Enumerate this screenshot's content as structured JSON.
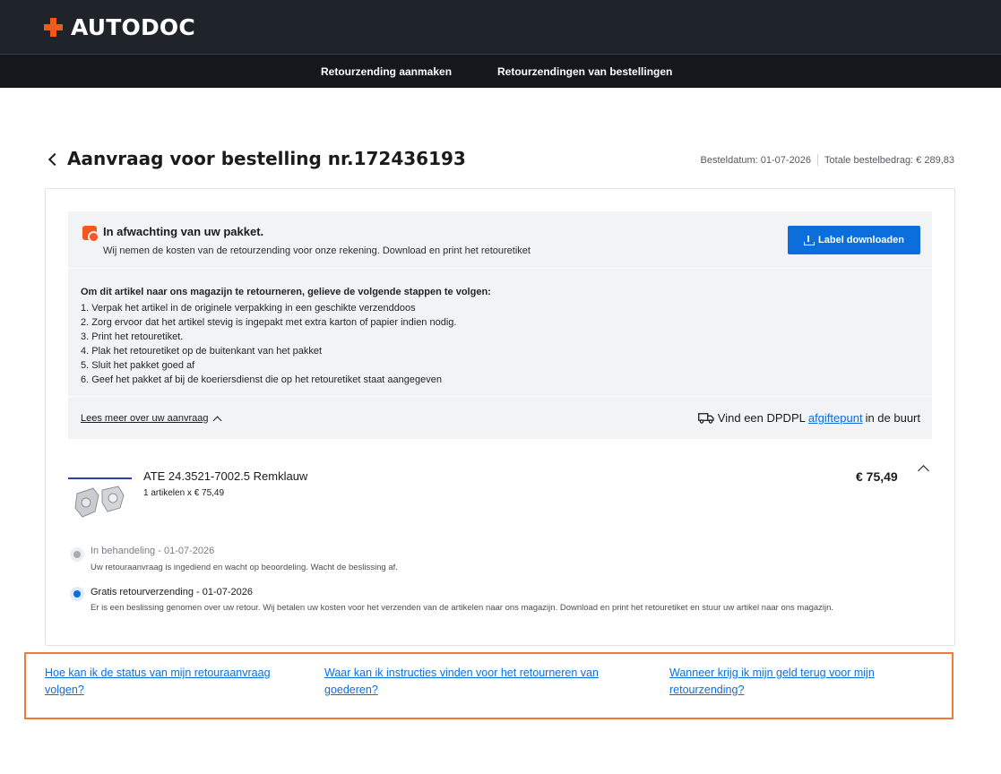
{
  "brand": {
    "name": "AUTODOC",
    "accent": "#f6571d"
  },
  "nav": {
    "create_return": "Retourzending aanmaken",
    "order_returns": "Retourzendingen van bestellingen"
  },
  "header": {
    "title": "Aanvraag voor bestelling nr.172436193",
    "order_date": "Besteldatum: 01-07-2026",
    "order_total": "Totale bestelbedrag: € 289,83"
  },
  "status": {
    "title": "In afwachting van uw pakket.",
    "subtitle": "Wij nemen de kosten van de retourzending voor onze rekening. Download en print het retouretiket",
    "download_label": "Label downloaden"
  },
  "steps": {
    "intro": "Om dit artikel naar ons magazijn te retourneren, gelieve de volgende stappen te volgen:",
    "items": [
      "1. Verpak het artikel in de originele verpakking in een geschikte verzenddoos",
      "2. Zorg ervoor dat het artikel stevig is ingepakt met extra karton of papier indien nodig.",
      "3. Print het retouretiket.",
      "4. Plak het retouretiket op de buitenkant van het pakket",
      "5. Sluit het pakket goed af",
      "6. Geef het pakket af bij de koeriersdienst die op het retouretiket staat aangegeven"
    ]
  },
  "read_more": "Lees meer over uw aanvraag",
  "dropoff": {
    "prefix": "Vind een DPDPL",
    "link": "afgiftepunt",
    "suffix": "in de buurt"
  },
  "product": {
    "name": "ATE 24.3521-7002.5 Remklauw",
    "qty": "1 artikelen x € 75,49",
    "price": "€ 75,49"
  },
  "timeline": [
    {
      "title": "In behandeling - 01-07-2026",
      "description": "Uw retouraanvraag is ingediend en wacht op beoordeling. Wacht de beslissing af.",
      "state": "done"
    },
    {
      "title": "Gratis retourverzending - 01-07-2026",
      "description": "Er is een beslissing genomen over uw retour. Wij betalen uw kosten voor het verzenden van de artikelen naar ons magazijn. Download en print het retouretiket en stuur uw artikel naar ons magazijn.",
      "state": "current"
    }
  ],
  "faq": {
    "q1_line1": "Hoe kan ik de status van mijn retouraanvraag",
    "q1_line2": "volgen?",
    "q2_line1": "Waar kan ik instructies vinden voor het retourneren van",
    "q2_line2": "goederen?",
    "q3_line1": "Wanneer krijg ik mijn geld terug voor mijn",
    "q3_line2": "retourzending?"
  }
}
